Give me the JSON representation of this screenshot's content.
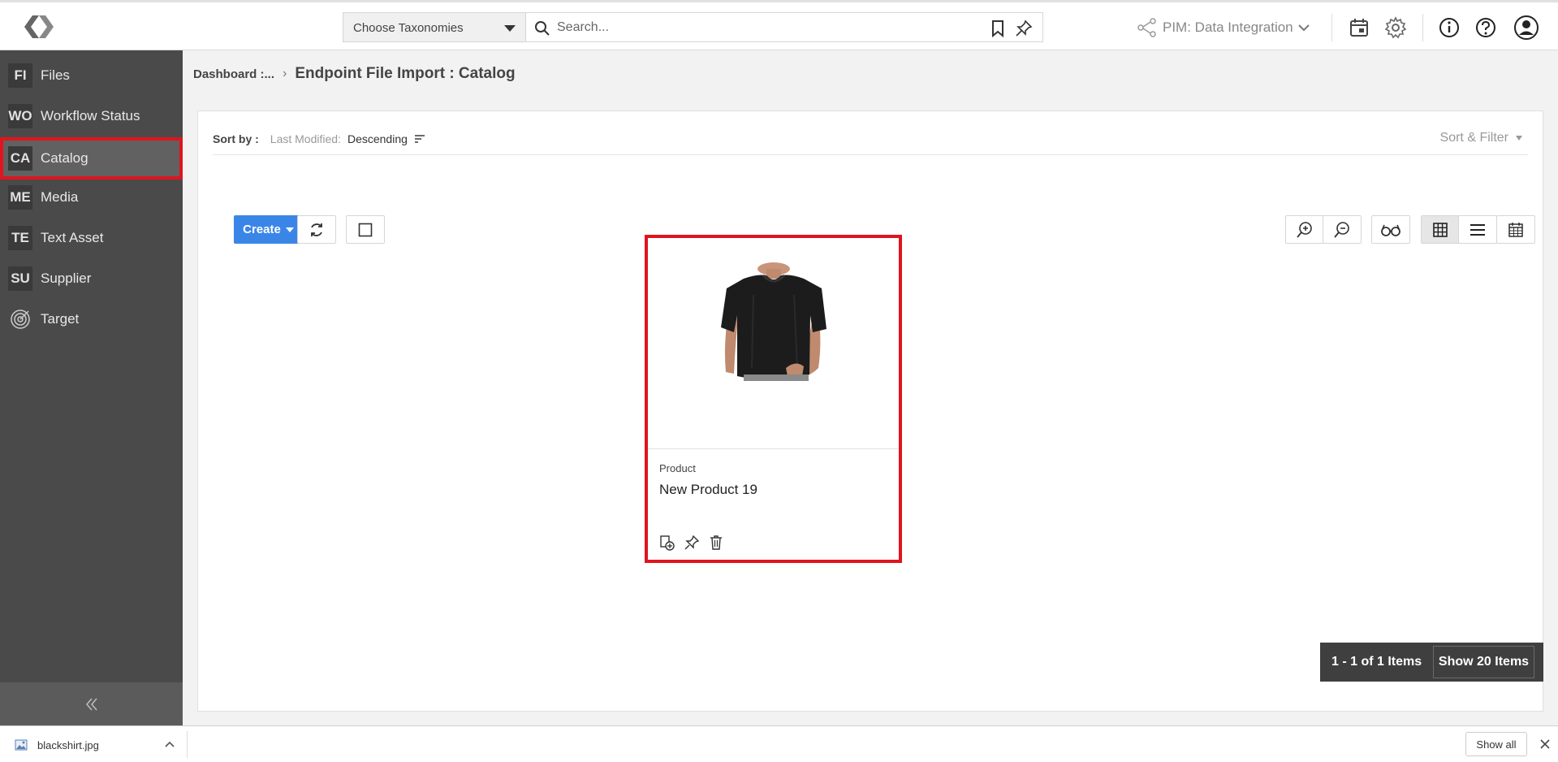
{
  "topbar": {
    "taxonomy_label": "Choose Taxonomies",
    "search_placeholder": "Search...",
    "pim_label": "PIM: Data Integration"
  },
  "sidebar": {
    "items": [
      {
        "abbr": "FI",
        "label": "Files"
      },
      {
        "abbr": "WO",
        "label": "Workflow Status"
      },
      {
        "abbr": "CA",
        "label": "Catalog",
        "active": true
      },
      {
        "abbr": "ME",
        "label": "Media"
      },
      {
        "abbr": "TE",
        "label": "Text Asset"
      },
      {
        "abbr": "SU",
        "label": "Supplier"
      },
      {
        "icon": "target-icon",
        "label": "Target"
      }
    ]
  },
  "breadcrumb": {
    "parent": "Dashboard :...",
    "current": "Endpoint File Import : Catalog"
  },
  "sort": {
    "label": "Sort by :",
    "field": "Last Modified:",
    "order": "Descending",
    "filter_label": "Sort & Filter"
  },
  "toolbar": {
    "create_label": "Create"
  },
  "cards": [
    {
      "type": "Product",
      "name": "New Product 19",
      "image": "black-tshirt"
    }
  ],
  "pager": {
    "count": "1 - 1 of 1 Items",
    "show_label": "Show 20 Items"
  },
  "downloads": {
    "file": "blackshirt.jpg",
    "show_all": "Show all"
  },
  "colors": {
    "sidebar_bg": "#4a4a4a",
    "accent_blue": "#3a86e8",
    "highlight_red": "#e0141e"
  }
}
